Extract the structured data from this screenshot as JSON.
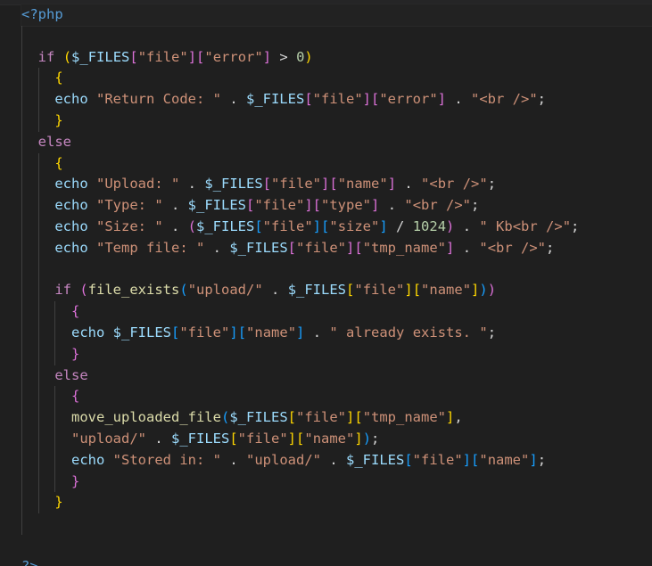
{
  "editor": {
    "language": "php",
    "lines": [
      {
        "indent": 0,
        "guides": [],
        "tokens": [
          {
            "t": "<?php",
            "c": "tag"
          }
        ]
      },
      {
        "indent": 0,
        "guides": [
          0
        ],
        "tokens": []
      },
      {
        "indent": 2,
        "guides": [
          0
        ],
        "tokens": [
          {
            "t": "if",
            "c": "kw"
          },
          {
            "t": " ",
            "c": "plain"
          },
          {
            "t": "(",
            "c": "b1"
          },
          {
            "t": "$_FILES",
            "c": "var"
          },
          {
            "t": "[",
            "c": "b2"
          },
          {
            "t": "\"file\"",
            "c": "str"
          },
          {
            "t": "]",
            "c": "b2"
          },
          {
            "t": "[",
            "c": "b2"
          },
          {
            "t": "\"error\"",
            "c": "str"
          },
          {
            "t": "]",
            "c": "b2"
          },
          {
            "t": " > ",
            "c": "op"
          },
          {
            "t": "0",
            "c": "num"
          },
          {
            "t": ")",
            "c": "b1"
          }
        ]
      },
      {
        "indent": 4,
        "guides": [
          0,
          2
        ],
        "tokens": [
          {
            "t": "{",
            "c": "b1"
          }
        ]
      },
      {
        "indent": 4,
        "guides": [
          0,
          2
        ],
        "tokens": [
          {
            "t": "echo",
            "c": "echo"
          },
          {
            "t": " ",
            "c": "plain"
          },
          {
            "t": "\"Return Code: \"",
            "c": "str"
          },
          {
            "t": " . ",
            "c": "op"
          },
          {
            "t": "$_FILES",
            "c": "var"
          },
          {
            "t": "[",
            "c": "b2"
          },
          {
            "t": "\"file\"",
            "c": "str"
          },
          {
            "t": "]",
            "c": "b2"
          },
          {
            "t": "[",
            "c": "b2"
          },
          {
            "t": "\"error\"",
            "c": "str"
          },
          {
            "t": "]",
            "c": "b2"
          },
          {
            "t": " . ",
            "c": "op"
          },
          {
            "t": "\"<br />\"",
            "c": "str"
          },
          {
            "t": ";",
            "c": "op"
          }
        ]
      },
      {
        "indent": 4,
        "guides": [
          0,
          2
        ],
        "tokens": [
          {
            "t": "}",
            "c": "b1"
          }
        ]
      },
      {
        "indent": 2,
        "guides": [
          0
        ],
        "tokens": [
          {
            "t": "else",
            "c": "kw"
          }
        ]
      },
      {
        "indent": 4,
        "guides": [
          0,
          2
        ],
        "tokens": [
          {
            "t": "{",
            "c": "b1"
          }
        ]
      },
      {
        "indent": 4,
        "guides": [
          0,
          2
        ],
        "tokens": [
          {
            "t": "echo",
            "c": "echo"
          },
          {
            "t": " ",
            "c": "plain"
          },
          {
            "t": "\"Upload: \"",
            "c": "str"
          },
          {
            "t": " . ",
            "c": "op"
          },
          {
            "t": "$_FILES",
            "c": "var"
          },
          {
            "t": "[",
            "c": "b2"
          },
          {
            "t": "\"file\"",
            "c": "str"
          },
          {
            "t": "]",
            "c": "b2"
          },
          {
            "t": "[",
            "c": "b2"
          },
          {
            "t": "\"name\"",
            "c": "str"
          },
          {
            "t": "]",
            "c": "b2"
          },
          {
            "t": " . ",
            "c": "op"
          },
          {
            "t": "\"<br />\"",
            "c": "str"
          },
          {
            "t": ";",
            "c": "op"
          }
        ]
      },
      {
        "indent": 4,
        "guides": [
          0,
          2
        ],
        "tokens": [
          {
            "t": "echo",
            "c": "echo"
          },
          {
            "t": " ",
            "c": "plain"
          },
          {
            "t": "\"Type: \"",
            "c": "str"
          },
          {
            "t": " . ",
            "c": "op"
          },
          {
            "t": "$_FILES",
            "c": "var"
          },
          {
            "t": "[",
            "c": "b2"
          },
          {
            "t": "\"file\"",
            "c": "str"
          },
          {
            "t": "]",
            "c": "b2"
          },
          {
            "t": "[",
            "c": "b2"
          },
          {
            "t": "\"type\"",
            "c": "str"
          },
          {
            "t": "]",
            "c": "b2"
          },
          {
            "t": " . ",
            "c": "op"
          },
          {
            "t": "\"<br />\"",
            "c": "str"
          },
          {
            "t": ";",
            "c": "op"
          }
        ]
      },
      {
        "indent": 4,
        "guides": [
          0,
          2
        ],
        "tokens": [
          {
            "t": "echo",
            "c": "echo"
          },
          {
            "t": " ",
            "c": "plain"
          },
          {
            "t": "\"Size: \"",
            "c": "str"
          },
          {
            "t": " . ",
            "c": "op"
          },
          {
            "t": "(",
            "c": "b2"
          },
          {
            "t": "$_FILES",
            "c": "var"
          },
          {
            "t": "[",
            "c": "b3"
          },
          {
            "t": "\"file\"",
            "c": "str"
          },
          {
            "t": "]",
            "c": "b3"
          },
          {
            "t": "[",
            "c": "b3"
          },
          {
            "t": "\"size\"",
            "c": "str"
          },
          {
            "t": "]",
            "c": "b3"
          },
          {
            "t": " / ",
            "c": "op"
          },
          {
            "t": "1024",
            "c": "num"
          },
          {
            "t": ")",
            "c": "b2"
          },
          {
            "t": " . ",
            "c": "op"
          },
          {
            "t": "\" Kb<br />\"",
            "c": "str"
          },
          {
            "t": ";",
            "c": "op"
          }
        ]
      },
      {
        "indent": 4,
        "guides": [
          0,
          2
        ],
        "tokens": [
          {
            "t": "echo",
            "c": "echo"
          },
          {
            "t": " ",
            "c": "plain"
          },
          {
            "t": "\"Temp file: \"",
            "c": "str"
          },
          {
            "t": " . ",
            "c": "op"
          },
          {
            "t": "$_FILES",
            "c": "var"
          },
          {
            "t": "[",
            "c": "b2"
          },
          {
            "t": "\"file\"",
            "c": "str"
          },
          {
            "t": "]",
            "c": "b2"
          },
          {
            "t": "[",
            "c": "b2"
          },
          {
            "t": "\"tmp_name\"",
            "c": "str"
          },
          {
            "t": "]",
            "c": "b2"
          },
          {
            "t": " . ",
            "c": "op"
          },
          {
            "t": "\"<br />\"",
            "c": "str"
          },
          {
            "t": ";",
            "c": "op"
          }
        ]
      },
      {
        "indent": 0,
        "guides": [
          0,
          2
        ],
        "tokens": []
      },
      {
        "indent": 4,
        "guides": [
          0,
          2
        ],
        "tokens": [
          {
            "t": "if",
            "c": "kw"
          },
          {
            "t": " ",
            "c": "plain"
          },
          {
            "t": "(",
            "c": "b2"
          },
          {
            "t": "file_exists",
            "c": "fn"
          },
          {
            "t": "(",
            "c": "b3"
          },
          {
            "t": "\"upload/\"",
            "c": "str"
          },
          {
            "t": " . ",
            "c": "op"
          },
          {
            "t": "$_FILES",
            "c": "var"
          },
          {
            "t": "[",
            "c": "b1"
          },
          {
            "t": "\"file\"",
            "c": "str"
          },
          {
            "t": "]",
            "c": "b1"
          },
          {
            "t": "[",
            "c": "b1"
          },
          {
            "t": "\"name\"",
            "c": "str"
          },
          {
            "t": "]",
            "c": "b1"
          },
          {
            "t": ")",
            "c": "b3"
          },
          {
            "t": ")",
            "c": "b2"
          }
        ]
      },
      {
        "indent": 6,
        "guides": [
          0,
          2,
          4
        ],
        "tokens": [
          {
            "t": "{",
            "c": "b2"
          }
        ]
      },
      {
        "indent": 6,
        "guides": [
          0,
          2,
          4
        ],
        "tokens": [
          {
            "t": "echo",
            "c": "echo"
          },
          {
            "t": " ",
            "c": "plain"
          },
          {
            "t": "$_FILES",
            "c": "var"
          },
          {
            "t": "[",
            "c": "b3"
          },
          {
            "t": "\"file\"",
            "c": "str"
          },
          {
            "t": "]",
            "c": "b3"
          },
          {
            "t": "[",
            "c": "b3"
          },
          {
            "t": "\"name\"",
            "c": "str"
          },
          {
            "t": "]",
            "c": "b3"
          },
          {
            "t": " . ",
            "c": "op"
          },
          {
            "t": "\" already exists. \"",
            "c": "str"
          },
          {
            "t": ";",
            "c": "op"
          }
        ]
      },
      {
        "indent": 6,
        "guides": [
          0,
          2,
          4
        ],
        "tokens": [
          {
            "t": "}",
            "c": "b2"
          }
        ]
      },
      {
        "indent": 4,
        "guides": [
          0,
          2
        ],
        "tokens": [
          {
            "t": "else",
            "c": "kw"
          }
        ]
      },
      {
        "indent": 6,
        "guides": [
          0,
          2,
          4
        ],
        "tokens": [
          {
            "t": "{",
            "c": "b2"
          }
        ]
      },
      {
        "indent": 6,
        "guides": [
          0,
          2,
          4
        ],
        "tokens": [
          {
            "t": "move_uploaded_file",
            "c": "fn"
          },
          {
            "t": "(",
            "c": "b3"
          },
          {
            "t": "$_FILES",
            "c": "var"
          },
          {
            "t": "[",
            "c": "b1"
          },
          {
            "t": "\"file\"",
            "c": "str"
          },
          {
            "t": "]",
            "c": "b1"
          },
          {
            "t": "[",
            "c": "b1"
          },
          {
            "t": "\"tmp_name\"",
            "c": "str"
          },
          {
            "t": "]",
            "c": "b1"
          },
          {
            "t": ",",
            "c": "op"
          }
        ]
      },
      {
        "indent": 6,
        "guides": [
          0,
          2,
          4
        ],
        "tokens": [
          {
            "t": "\"upload/\"",
            "c": "str"
          },
          {
            "t": " . ",
            "c": "op"
          },
          {
            "t": "$_FILES",
            "c": "var"
          },
          {
            "t": "[",
            "c": "b1"
          },
          {
            "t": "\"file\"",
            "c": "str"
          },
          {
            "t": "]",
            "c": "b1"
          },
          {
            "t": "[",
            "c": "b1"
          },
          {
            "t": "\"name\"",
            "c": "str"
          },
          {
            "t": "]",
            "c": "b1"
          },
          {
            "t": ")",
            "c": "b3"
          },
          {
            "t": ";",
            "c": "op"
          }
        ]
      },
      {
        "indent": 6,
        "guides": [
          0,
          2,
          4
        ],
        "tokens": [
          {
            "t": "echo",
            "c": "echo"
          },
          {
            "t": " ",
            "c": "plain"
          },
          {
            "t": "\"Stored in: \"",
            "c": "str"
          },
          {
            "t": " . ",
            "c": "op"
          },
          {
            "t": "\"upload/\"",
            "c": "str"
          },
          {
            "t": " . ",
            "c": "op"
          },
          {
            "t": "$_FILES",
            "c": "var"
          },
          {
            "t": "[",
            "c": "b3"
          },
          {
            "t": "\"file\"",
            "c": "str"
          },
          {
            "t": "]",
            "c": "b3"
          },
          {
            "t": "[",
            "c": "b3"
          },
          {
            "t": "\"name\"",
            "c": "str"
          },
          {
            "t": "]",
            "c": "b3"
          },
          {
            "t": ";",
            "c": "op"
          }
        ]
      },
      {
        "indent": 6,
        "guides": [
          0,
          2,
          4
        ],
        "tokens": [
          {
            "t": "}",
            "c": "b2"
          }
        ]
      },
      {
        "indent": 4,
        "guides": [
          0,
          2
        ],
        "tokens": [
          {
            "t": "}",
            "c": "b1"
          }
        ]
      },
      {
        "indent": 0,
        "guides": [
          0
        ],
        "tokens": []
      },
      {
        "indent": 0,
        "guides": [],
        "tokens": []
      },
      {
        "indent": 0,
        "guides": [],
        "tokens": [
          {
            "t": "?>",
            "c": "tag"
          }
        ]
      }
    ]
  },
  "colors": {
    "background": "#1f1f1f",
    "tag": "#569cd6",
    "keyword": "#c586c0",
    "function": "#dcdcaa",
    "variable": "#9cdcfe",
    "string": "#ce9178",
    "number": "#b5cea8",
    "bracket_level_1": "#ffd700",
    "bracket_level_2": "#da70d6",
    "bracket_level_3": "#179fff"
  }
}
